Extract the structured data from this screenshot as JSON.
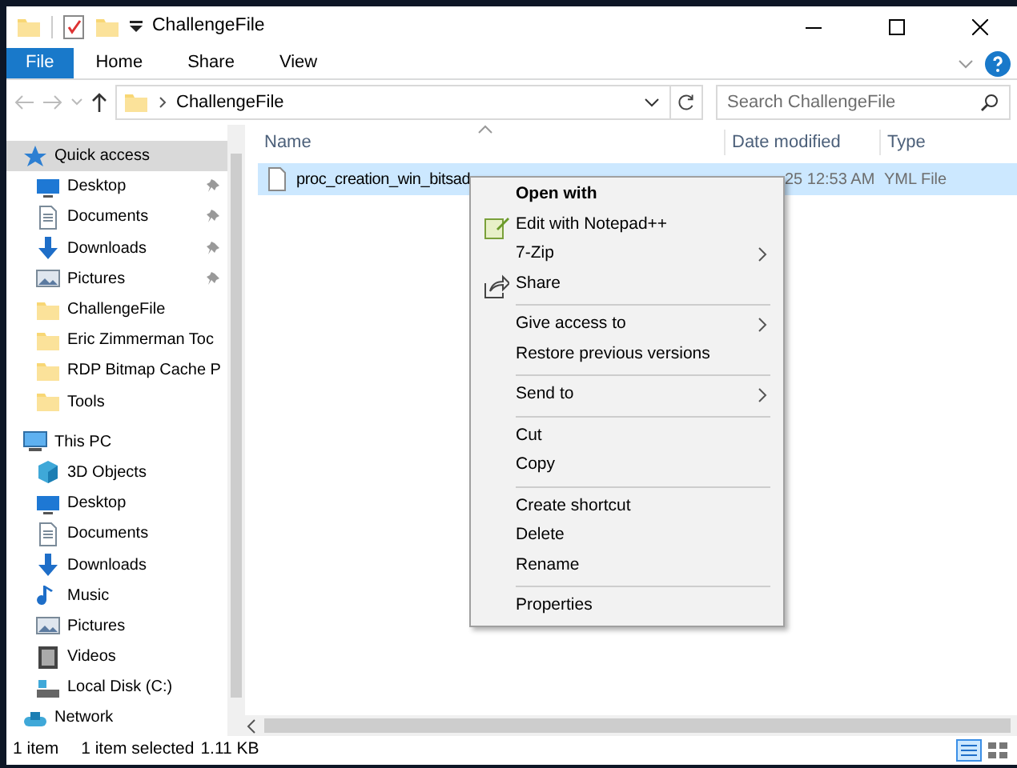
{
  "window": {
    "title": "ChallengeFile"
  },
  "ribbon_tabs": [
    {
      "label": "File",
      "kind": "file"
    },
    {
      "label": "Home",
      "kind": "tab"
    },
    {
      "label": "Share",
      "kind": "tab"
    },
    {
      "label": "View",
      "kind": "tab"
    }
  ],
  "address": {
    "path": "ChallengeFile"
  },
  "search": {
    "placeholder": "Search ChallengeFile"
  },
  "sidebar": {
    "items": [
      {
        "label": "Quick access",
        "kind": "star",
        "selected": true,
        "children": [
          {
            "label": "Desktop",
            "kind": "desktop",
            "pinned": true,
            "selected": false
          },
          {
            "label": "Documents",
            "kind": "documents",
            "pinned": true,
            "selected": false
          },
          {
            "label": "Downloads",
            "kind": "downloads",
            "pinned": true,
            "selected": false
          },
          {
            "label": "Pictures",
            "kind": "pictures",
            "pinned": true,
            "selected": false
          },
          {
            "label": "ChallengeFile",
            "kind": "folder",
            "pinned": false,
            "selected": false
          },
          {
            "label": "Eric Zimmerman Toc",
            "kind": "folder",
            "pinned": false,
            "selected": false
          },
          {
            "label": "RDP Bitmap Cache P",
            "kind": "folder",
            "pinned": false,
            "selected": false
          },
          {
            "label": "Tools",
            "kind": "folder",
            "pinned": false,
            "selected": false
          }
        ]
      },
      {
        "label": "This PC",
        "kind": "pc",
        "selected": false,
        "children": [
          {
            "label": "3D Objects",
            "kind": "cube",
            "pinned": false,
            "selected": false
          },
          {
            "label": "Desktop",
            "kind": "desktop",
            "pinned": false,
            "selected": false
          },
          {
            "label": "Documents",
            "kind": "documents",
            "pinned": false,
            "selected": false
          },
          {
            "label": "Downloads",
            "kind": "downloads",
            "pinned": false,
            "selected": false
          },
          {
            "label": "Music",
            "kind": "music",
            "pinned": false,
            "selected": false
          },
          {
            "label": "Pictures",
            "kind": "pictures",
            "pinned": false,
            "selected": false
          },
          {
            "label": "Videos",
            "kind": "videos",
            "pinned": false,
            "selected": false
          },
          {
            "label": "Local Disk (C:)",
            "kind": "disk",
            "pinned": false,
            "selected": false
          }
        ]
      },
      {
        "label": "Network",
        "kind": "network",
        "selected": false
      }
    ]
  },
  "columns": [
    "Name",
    "Date modified",
    "Type"
  ],
  "files": [
    {
      "name": "proc_creation_win_bitsad",
      "date": "25 12:53 AM",
      "type": "YML File",
      "selected": true
    }
  ],
  "context_menu": {
    "items": [
      {
        "kind": "item",
        "label": "Open with",
        "default": true,
        "submenu": false
      },
      {
        "kind": "notepad",
        "label": "Edit with Notepad++",
        "default": false,
        "submenu": false
      },
      {
        "kind": "item",
        "label": "7-Zip",
        "default": false,
        "submenu": true
      },
      {
        "kind": "share",
        "label": "Share",
        "default": false,
        "submenu": false
      },
      {
        "kind": "separator"
      },
      {
        "kind": "item",
        "label": "Give access to",
        "default": false,
        "submenu": true
      },
      {
        "kind": "item",
        "label": "Restore previous versions",
        "default": false,
        "submenu": false
      },
      {
        "kind": "separator"
      },
      {
        "kind": "item",
        "label": "Send to",
        "default": false,
        "submenu": true
      },
      {
        "kind": "separator"
      },
      {
        "kind": "item",
        "label": "Cut",
        "default": false,
        "submenu": false
      },
      {
        "kind": "item",
        "label": "Copy",
        "default": false,
        "submenu": false
      },
      {
        "kind": "separator"
      },
      {
        "kind": "item",
        "label": "Create shortcut",
        "default": false,
        "submenu": false
      },
      {
        "kind": "item",
        "label": "Delete",
        "default": false,
        "submenu": false
      },
      {
        "kind": "item",
        "label": "Rename",
        "default": false,
        "submenu": false
      },
      {
        "kind": "separator"
      },
      {
        "kind": "item",
        "label": "Properties",
        "default": false,
        "submenu": false
      }
    ]
  },
  "status_bar": {
    "count": "1 item",
    "selection": "1 item selected",
    "size": "1.11 KB"
  }
}
